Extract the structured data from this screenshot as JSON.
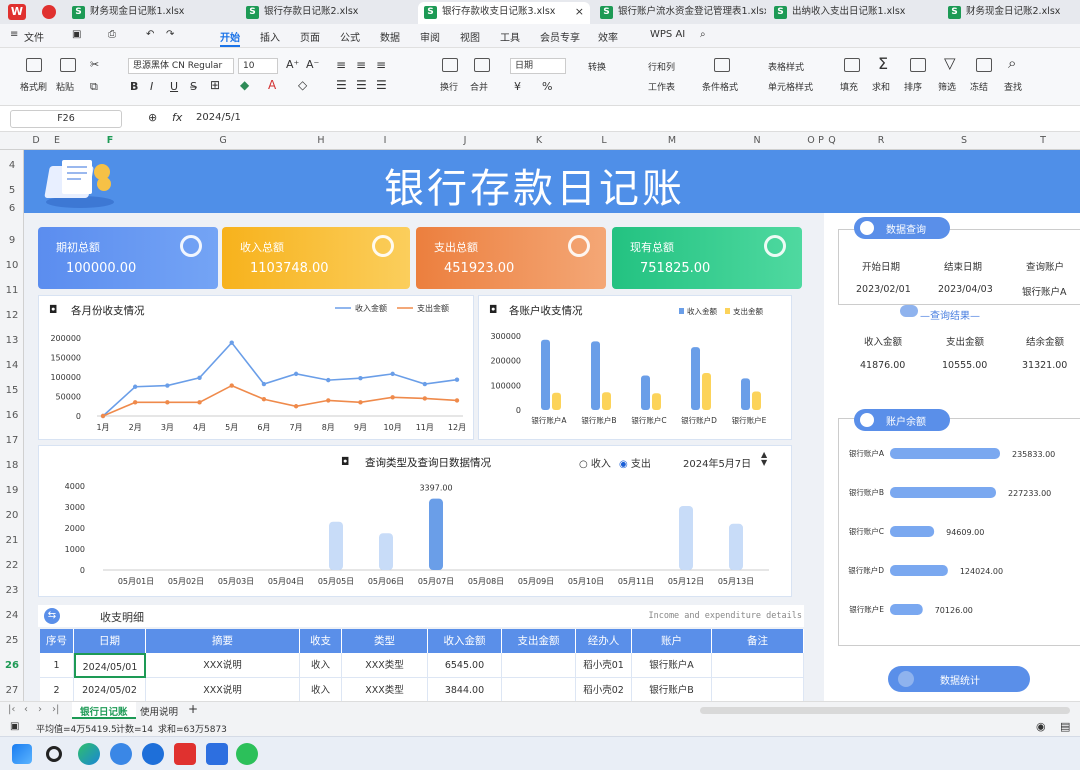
{
  "app_tabs": [
    {
      "label": "财务现金日记账1.xlsx"
    },
    {
      "label": "银行存款日记账2.xlsx"
    },
    {
      "label": "银行存款收支日记账3.xlsx"
    },
    {
      "label": "银行账户流水资金登记管理表1.xlsx"
    },
    {
      "label": "出纳收入支出日记账1.xlsx"
    },
    {
      "label": "财务现金日记账2.xlsx"
    }
  ],
  "menu": {
    "file": "文件",
    "items": [
      "开始",
      "插入",
      "页面",
      "公式",
      "数据",
      "审阅",
      "视图",
      "工具",
      "会员专享",
      "效率"
    ],
    "wps_ai": "WPS AI"
  },
  "ribbon": {
    "format_painter": "格式刷",
    "paste": "粘贴",
    "font_name": "思源黑体 CN Regular",
    "font_size": "10",
    "wrap": "换行",
    "merge": "合并",
    "num_format": "日期",
    "convert": "转换",
    "rows_cols": "行和列",
    "worksheet": "工作表",
    "cond_format": "条件格式",
    "table_style": "表格样式",
    "cell_style": "单元格样式",
    "fill": "填充",
    "sum": "求和",
    "sort": "排序",
    "filter": "筛选",
    "freeze": "冻结",
    "find": "查找"
  },
  "formula_bar": {
    "cell_ref": "F26",
    "fx": "fx",
    "value": "2024/5/1"
  },
  "columns": [
    "D",
    "E",
    "F",
    "G",
    "H",
    "I",
    "J",
    "K",
    "L",
    "M",
    "N",
    "O",
    "P",
    "Q",
    "R",
    "S",
    "T"
  ],
  "rows": [
    "4",
    "5",
    "6",
    "9",
    "10",
    "11",
    "12",
    "13",
    "14",
    "15",
    "16",
    "17",
    "18",
    "19",
    "20",
    "21",
    "22",
    "23",
    "24",
    "25",
    "26",
    "27"
  ],
  "dashboard": {
    "title": "银行存款日记账",
    "kpis": [
      {
        "label": "期初总额",
        "value": "100000.00",
        "color": "#5a8fe9"
      },
      {
        "label": "收入总额",
        "value": "1103748.00",
        "color": "#f8b827"
      },
      {
        "label": "支出总额",
        "value": "451923.00",
        "color": "#ef8a4b"
      },
      {
        "label": "现有总额",
        "value": "751825.00",
        "color": "#2ecb8a"
      }
    ],
    "monthly_title": "各月份收支情况",
    "account_title": "各账户收支情况",
    "daily_title": "查询类型及查询日数据情况",
    "radio_income": "收入",
    "radio_expense": "支出",
    "query_date": "2024年5月7日",
    "detail_title": "收支明细",
    "detail_en": "Income and expenditure details"
  },
  "right_panel": {
    "query_label": "数据查询",
    "headers": [
      "开始日期",
      "结束日期",
      "查询账户"
    ],
    "values": [
      "2023/02/01",
      "2023/04/03",
      "银行账户A"
    ],
    "result_label": "查询结果",
    "result_headers": [
      "收入金额",
      "支出金额",
      "结余金额"
    ],
    "result_values": [
      "41876.00",
      "10555.00",
      "31321.00"
    ],
    "balance_label": "账户余额",
    "stats_label": "数据统计"
  },
  "table": {
    "headers": [
      "序号",
      "日期",
      "摘要",
      "收支",
      "类型",
      "收入金额",
      "支出金额",
      "经办人",
      "账户",
      "备注"
    ],
    "rows": [
      [
        "1",
        "2024/05/01",
        "XXX说明",
        "收入",
        "XXX类型",
        "6545.00",
        "",
        "稻小壳01",
        "银行账户A",
        ""
      ],
      [
        "2",
        "2024/05/02",
        "XXX说明",
        "收入",
        "XXX类型",
        "3844.00",
        "",
        "稻小壳02",
        "银行账户B",
        ""
      ]
    ]
  },
  "sheet_tabs": [
    "银行日记账",
    "使用说明"
  ],
  "status": {
    "avg": "平均值=4万5419.5",
    "count": "计数=14",
    "sum": "求和=63万5873"
  },
  "chart_data": [
    {
      "type": "line",
      "title": "各月份收支情况",
      "categories": [
        "1月",
        "2月",
        "3月",
        "4月",
        "5月",
        "6月",
        "7月",
        "8月",
        "9月",
        "10月",
        "11月",
        "12月"
      ],
      "series": [
        {
          "name": "收入金额",
          "color": "#6a9ee8",
          "values": [
            0,
            75000,
            78000,
            98000,
            188000,
            82000,
            108000,
            92000,
            97000,
            108000,
            82000,
            93000
          ]
        },
        {
          "name": "支出金额",
          "color": "#ef8a4b",
          "values": [
            0,
            35000,
            35000,
            35000,
            78000,
            43000,
            25000,
            40000,
            35000,
            48000,
            45000,
            40000
          ]
        }
      ],
      "yticks": [
        "200000",
        "150000",
        "100000",
        "50000",
        "0"
      ],
      "ylim": [
        0,
        200000
      ]
    },
    {
      "type": "bar",
      "title": "各账户收支情况",
      "categories": [
        "银行账户A",
        "银行账户B",
        "银行账户C",
        "银行账户D",
        "银行账户E"
      ],
      "series": [
        {
          "name": "收入金额",
          "color": "#6a9ee8",
          "values": [
            285000,
            278000,
            140000,
            255000,
            128000
          ]
        },
        {
          "name": "支出金额",
          "color": "#fcd35a",
          "values": [
            70000,
            72000,
            68000,
            150000,
            75000
          ]
        }
      ],
      "yticks": [
        "300000",
        "200000",
        "100000",
        "0"
      ],
      "ylim": [
        0,
        300000
      ]
    },
    {
      "type": "bar",
      "title": "查询类型及查询日数据情况",
      "categories": [
        "05月01日",
        "05月02日",
        "05月03日",
        "05月04日",
        "05月05日",
        "05月06日",
        "05月07日",
        "05月08日",
        "05月09日",
        "05月10日",
        "05月11日",
        "05月12日",
        "05月13日"
      ],
      "values": [
        0,
        0,
        0,
        0,
        2300,
        1750,
        3397,
        0,
        0,
        0,
        0,
        3050,
        2200
      ],
      "data_labels": [
        "",
        "",
        "",
        "",
        "",
        "",
        "3397.00",
        "",
        "",
        "",
        "",
        "",
        ""
      ],
      "yticks": [
        "4000",
        "3000",
        "2000",
        "1000",
        "0"
      ],
      "ylim": [
        0,
        4000
      ]
    },
    {
      "type": "bar",
      "title": "账户余额",
      "categories": [
        "银行账户A",
        "银行账户B",
        "银行账户C",
        "银行账户D",
        "银行账户E"
      ],
      "values": [
        235833,
        227233,
        94609,
        124024,
        70126
      ],
      "data_labels": [
        "235833.00",
        "227233.00",
        "94609.00",
        "124024.00",
        "70126.00"
      ]
    }
  ]
}
